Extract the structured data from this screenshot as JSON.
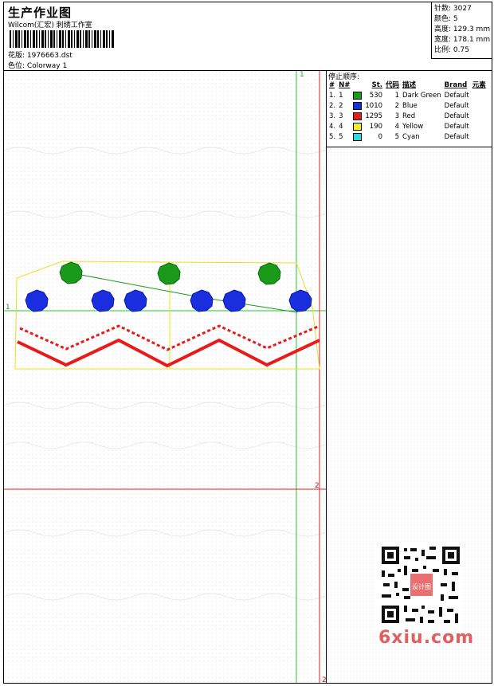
{
  "header": {
    "title": "生产作业图",
    "subtitle": "Wilcom(汇宏) 刺绣工作室",
    "design_label": "花版:",
    "design_value": "1976663.dst",
    "colorway_label": "色位:",
    "colorway_value": "Colorway 1"
  },
  "stats": [
    {
      "label": "针数:",
      "value": "3027"
    },
    {
      "label": "颜色:",
      "value": "5"
    },
    {
      "label": "高度:",
      "value": "129.3 mm"
    },
    {
      "label": "宽度:",
      "value": "178.1 mm"
    },
    {
      "label": "比例:",
      "value": "0.75"
    }
  ],
  "stop_sequence": {
    "title": "停止顺序:",
    "headers": [
      "#",
      "N#",
      "",
      "St.",
      "代码",
      "描述",
      "Brand",
      "元素"
    ],
    "rows": [
      {
        "idx": "1.",
        "n": "1",
        "color": "#1a9a1a",
        "st": "530",
        "code": "1",
        "desc": "Dark Green",
        "brand": "Default"
      },
      {
        "idx": "2.",
        "n": "2",
        "color": "#1a2ee0",
        "st": "1010",
        "code": "2",
        "desc": "Blue",
        "brand": "Default"
      },
      {
        "idx": "3.",
        "n": "3",
        "color": "#e81a1a",
        "st": "1295",
        "code": "3",
        "desc": "Red",
        "brand": "Default"
      },
      {
        "idx": "4.",
        "n": "4",
        "color": "#f0f020",
        "st": "190",
        "code": "4",
        "desc": "Yellow",
        "brand": "Default"
      },
      {
        "idx": "5.",
        "n": "5",
        "color": "#30d8e0",
        "st": "0",
        "code": "5",
        "desc": "Cyan",
        "brand": "Default"
      }
    ]
  },
  "guides": {
    "v_label": "1",
    "h_label": "1",
    "red_h_label": "2",
    "red_v_label": "2"
  },
  "colors": {
    "green_guide": "#22cc22",
    "red_guide": "#e02020",
    "outline": "#e8e020"
  },
  "watermark": "6xiu.com",
  "qr_stamp": "设计图"
}
